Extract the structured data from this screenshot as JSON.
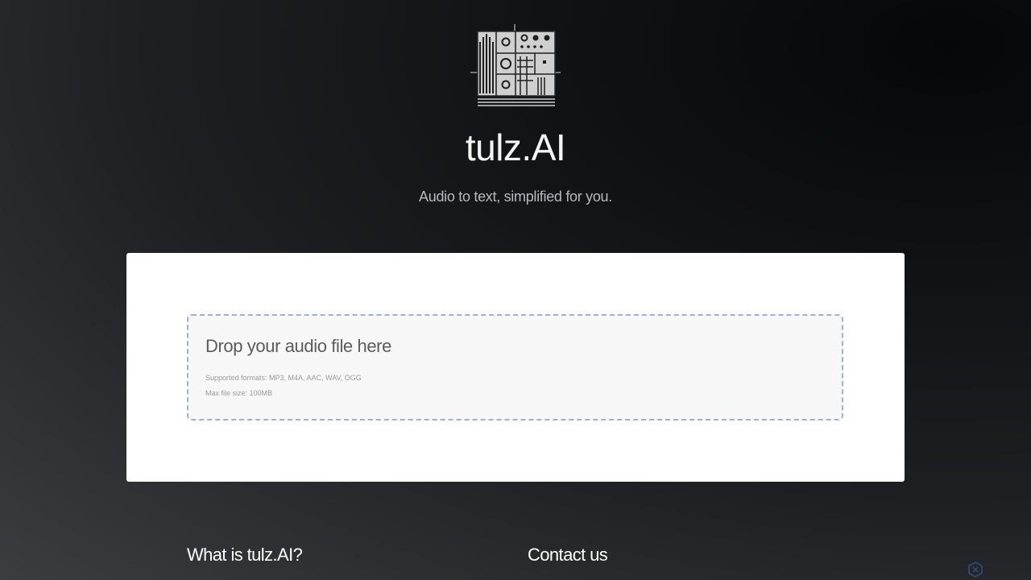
{
  "brand": {
    "logo_icon": "synthesizer-grid-logo-icon",
    "title": "tulz.AI",
    "tagline": "Audio to text, simplified for you."
  },
  "upload": {
    "dropzone_title": "Drop your audio file here",
    "supported_formats": "Supported formats: MP3, M4A, AAC, WAV, OGG",
    "max_file_size": "Max file size: 100MB"
  },
  "footer": {
    "what_is_heading": "What is tulz.AI?",
    "contact_heading": "Contact us"
  },
  "corner_widget": {
    "icon": "hexagon-badge-icon"
  },
  "colors": {
    "card_background": "#ffffff",
    "dropzone_background": "#f7f7f7",
    "dropzone_border": "#9fb1d3",
    "page_background_dark": "#111214"
  }
}
